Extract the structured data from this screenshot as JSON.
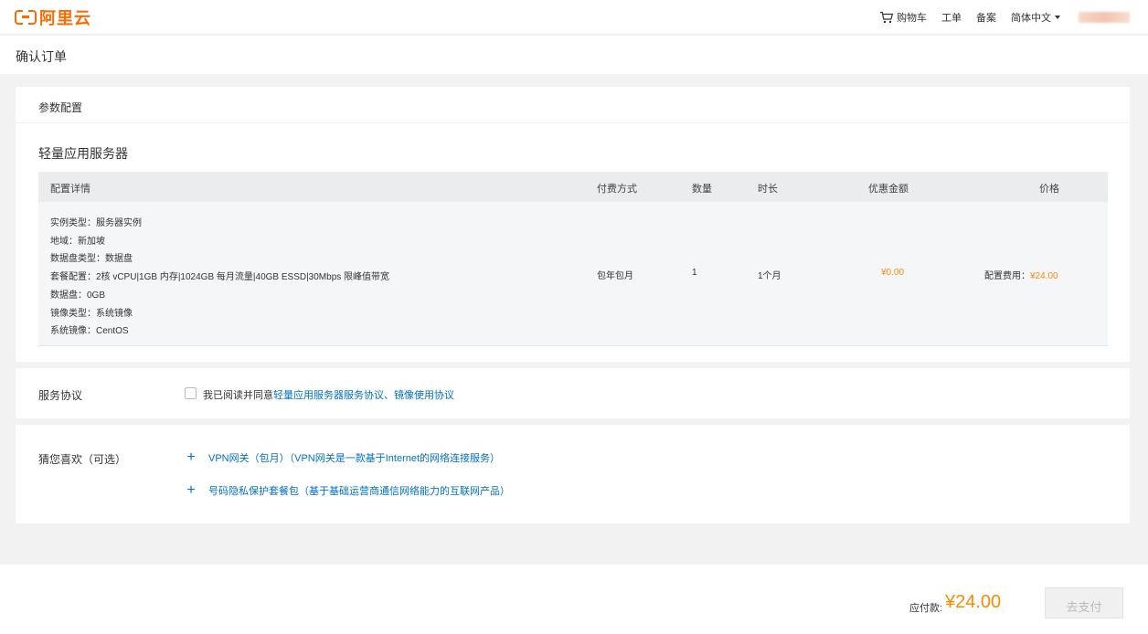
{
  "header": {
    "logo_text": "阿里云",
    "cart_label": "购物车",
    "ticket_label": "工单",
    "filing_label": "备案",
    "language_label": "简体中文"
  },
  "page": {
    "title": "确认订单"
  },
  "config_section": {
    "title": "参数配置",
    "product_name": "轻量应用服务器",
    "columns": [
      "配置详情",
      "付费方式",
      "数量",
      "时长",
      "优惠金额",
      "价格"
    ],
    "details": [
      "实例类型：服务器实例",
      "地域：新加坡",
      "数据盘类型：数据盘",
      "套餐配置：2核 vCPU|1GB 内存|1024GB 每月流量|40GB ESSD|30Mbps 限峰值带宽",
      "数据盘：0GB",
      "镜像类型：系统镜像",
      "系统镜像：CentOS"
    ],
    "pay_method": "包年包月",
    "quantity": "1",
    "duration": "1个月",
    "discount": "¥0.00",
    "price_label": "配置费用：",
    "price_value": "¥24.00"
  },
  "agreement": {
    "label": "服务协议",
    "prefix": "我已阅读并同意",
    "link1": "轻量应用服务器服务协议",
    "separator": "、",
    "link2": "镜像使用协议"
  },
  "recommend": {
    "label": "猜您喜欢（可选）",
    "items": [
      {
        "text": "VPN网关（包月）（VPN网关是一款基于Internet的网络连接服务）"
      },
      {
        "text": "号码隐私保护套餐包（基于基础运营商通信网络能力的互联网产品）"
      }
    ]
  },
  "footer": {
    "pay_label": "应付款:",
    "pay_amount": "¥24.00",
    "pay_button": "去支付"
  },
  "colors": {
    "brand": "#ff6a00",
    "price": "#ff8a00",
    "link": "#0070cc"
  }
}
